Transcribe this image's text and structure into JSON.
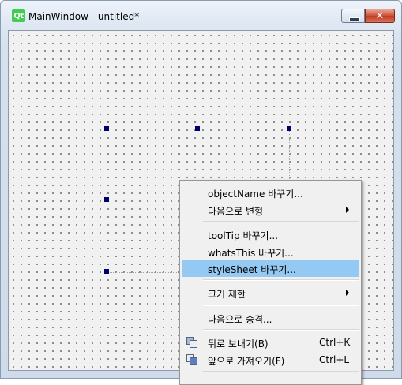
{
  "window": {
    "title": "MainWindow - untitled*",
    "logo_text": "Qt",
    "close_glyph": "✕"
  },
  "menu": {
    "items": [
      {
        "label": "objectName 바꾸기...",
        "shortcut": "",
        "submenu": false
      },
      {
        "label": "다음으로 변형",
        "shortcut": "",
        "submenu": true
      },
      {
        "label": "toolTip 바꾸기...",
        "shortcut": "",
        "submenu": false
      },
      {
        "label": "whatsThis 바꾸기...",
        "shortcut": "",
        "submenu": false
      },
      {
        "label": "styleSheet 바꾸기...",
        "shortcut": "",
        "submenu": false,
        "highlighted": true
      },
      {
        "label": "크기 제한",
        "shortcut": "",
        "submenu": true
      },
      {
        "label": "다음으로 승격...",
        "shortcut": "",
        "submenu": false
      },
      {
        "label": "뒤로 보내기(B)",
        "shortcut": "Ctrl+K",
        "submenu": false,
        "icon": "send-to-back-icon"
      },
      {
        "label": "앞으로 가져오기(F)",
        "shortcut": "Ctrl+L",
        "submenu": false,
        "icon": "bring-to-front-icon"
      }
    ]
  },
  "colors": {
    "highlight": "#93c9f3",
    "handle": "#00006b",
    "qt_green": "#41cd52"
  }
}
